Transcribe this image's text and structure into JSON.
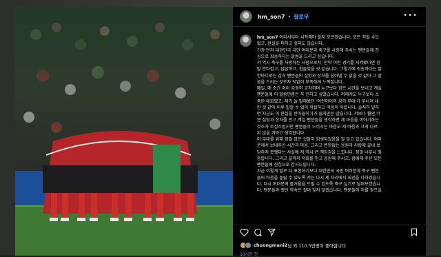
{
  "post": {
    "username": "hm_son7",
    "separator": "•",
    "follow_label": "팔로우",
    "menu_icon": "more-horizontal-icon",
    "caption_lines": [
      "어디서부터 시작해야 할지 모르겠습니다. 모든 척할 수도",
      "없고, 현실을 피하고 싶지도 않습니다.",
      "가장 먼저 대한민국 국민 여러분과 축구를 사랑해 주시는 팬분들께 진",
      "심으로 죄송하다는 말씀을 드리고 싶습니다.",
      "저 역시 축구를 사랑하는 사람으로서, 만약 이런 경기를 지켜봤다면 정",
      "말 안타깝고, 답답하고, 힘들었을 것 같습니다. 그렇기에 죄송하다는 말",
      "한마디로는 감히 팬분들의 실망과 상처를 담아낼 수 없을 것 같아 그 말",
      "씀을 드리는 것조차 턱없이 부족하게 느껴집니다.",
      "매일, 매 순간 여러 감정이 교차하며 누구보다 힘든 시간을 보내고 계실",
      "팬분들께 이 말씀만큼은 꼭 전하고 싶었습니다. 저에게도 누구보다 소",
      "중한 대회였고, 제가 늘 말해왔던 '어린아이의 꿈의 무대'가 무너져 내",
      "린 것 같아 이루 말할 수 없이 착잡하고 마음이 아픕니다. 솔직히 말하",
      "면 지금도 이 현실을 받아들이기가 쉽지만은 않습니다. 저보다 훨씬 더",
      "큰 실망과 상처를 안고 계실 팬분들을 생각하면 제 마음을 이야기하는",
      "것조차 조심스럽지만 팬분들이 느끼시는 마음도 제 마음과 크게 다르",
      "지 않을 거라고 생각합니다.",
      "이 무대를 위해 정말 많은 것들이 희생되었음을 잘 알고 있습니다. 여러",
      "분께서 보내주신 시간과 마음, 그리고 변함없는 응원과 사랑에 끝내 보",
      "답하지 못했다는 사실에 저 역시 큰 책임감을 느낍니다. 정말 너무나 죄",
      "송합니다. 그리고 끝까지 저희를 믿고 응원해 주시고, 함께해 주신 모든",
      "팬분들께 진심으로 감사드립니다.",
      "지금 이렇게 말로 다 표현하기보다 대한민국 국민 여러분과 축구 팬분",
      "들의 마음을 돌릴 수 있도록 저는 다시 제 자리에서 최선을 다하겠습니",
      "다. 다시 여러분께 즐거움을 드릴 수 있도록 축구 실기로 달려보겠습니",
      "다. 팬분들과 했던 약속은 절대 잊지 않겠습니다. 팬분들이 저를 찾으실"
    ],
    "actions": {
      "like_icon": "heart-icon",
      "comment_icon": "comment-icon",
      "share_icon": "send-icon",
      "save_icon": "bookmark-icon"
    },
    "likes_user": "choongmani2",
    "likes_text": "님 외 110.5만명이 좋아합니다",
    "timestamp": "10시간 전"
  },
  "colors": {
    "accent": "#4aa3ff",
    "background": "#000000",
    "text": "#e6e6e6"
  }
}
